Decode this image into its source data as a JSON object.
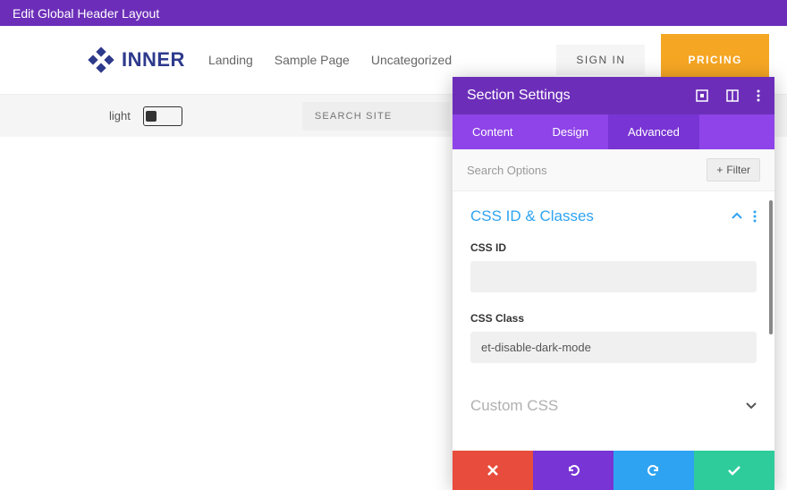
{
  "topbar": {
    "title": "Edit Global Header Layout"
  },
  "header": {
    "logo_text": "INNER",
    "nav": [
      "Landing",
      "Sample Page",
      "Uncategorized"
    ],
    "signin": "SIGN IN",
    "pricing": "PRICING"
  },
  "subbar": {
    "light_label": "light",
    "search_placeholder": "SEARCH SITE"
  },
  "panel": {
    "title": "Section Settings",
    "tabs": [
      "Content",
      "Design",
      "Advanced"
    ],
    "active_tab": 2,
    "search_label": "Search Options",
    "filter_label": "Filter",
    "sections": {
      "css_id_classes": {
        "title": "CSS ID & Classes",
        "fields": {
          "css_id": {
            "label": "CSS ID",
            "value": ""
          },
          "css_class": {
            "label": "CSS Class",
            "value": "et-disable-dark-mode"
          }
        }
      },
      "custom_css": {
        "title": "Custom CSS"
      }
    }
  }
}
